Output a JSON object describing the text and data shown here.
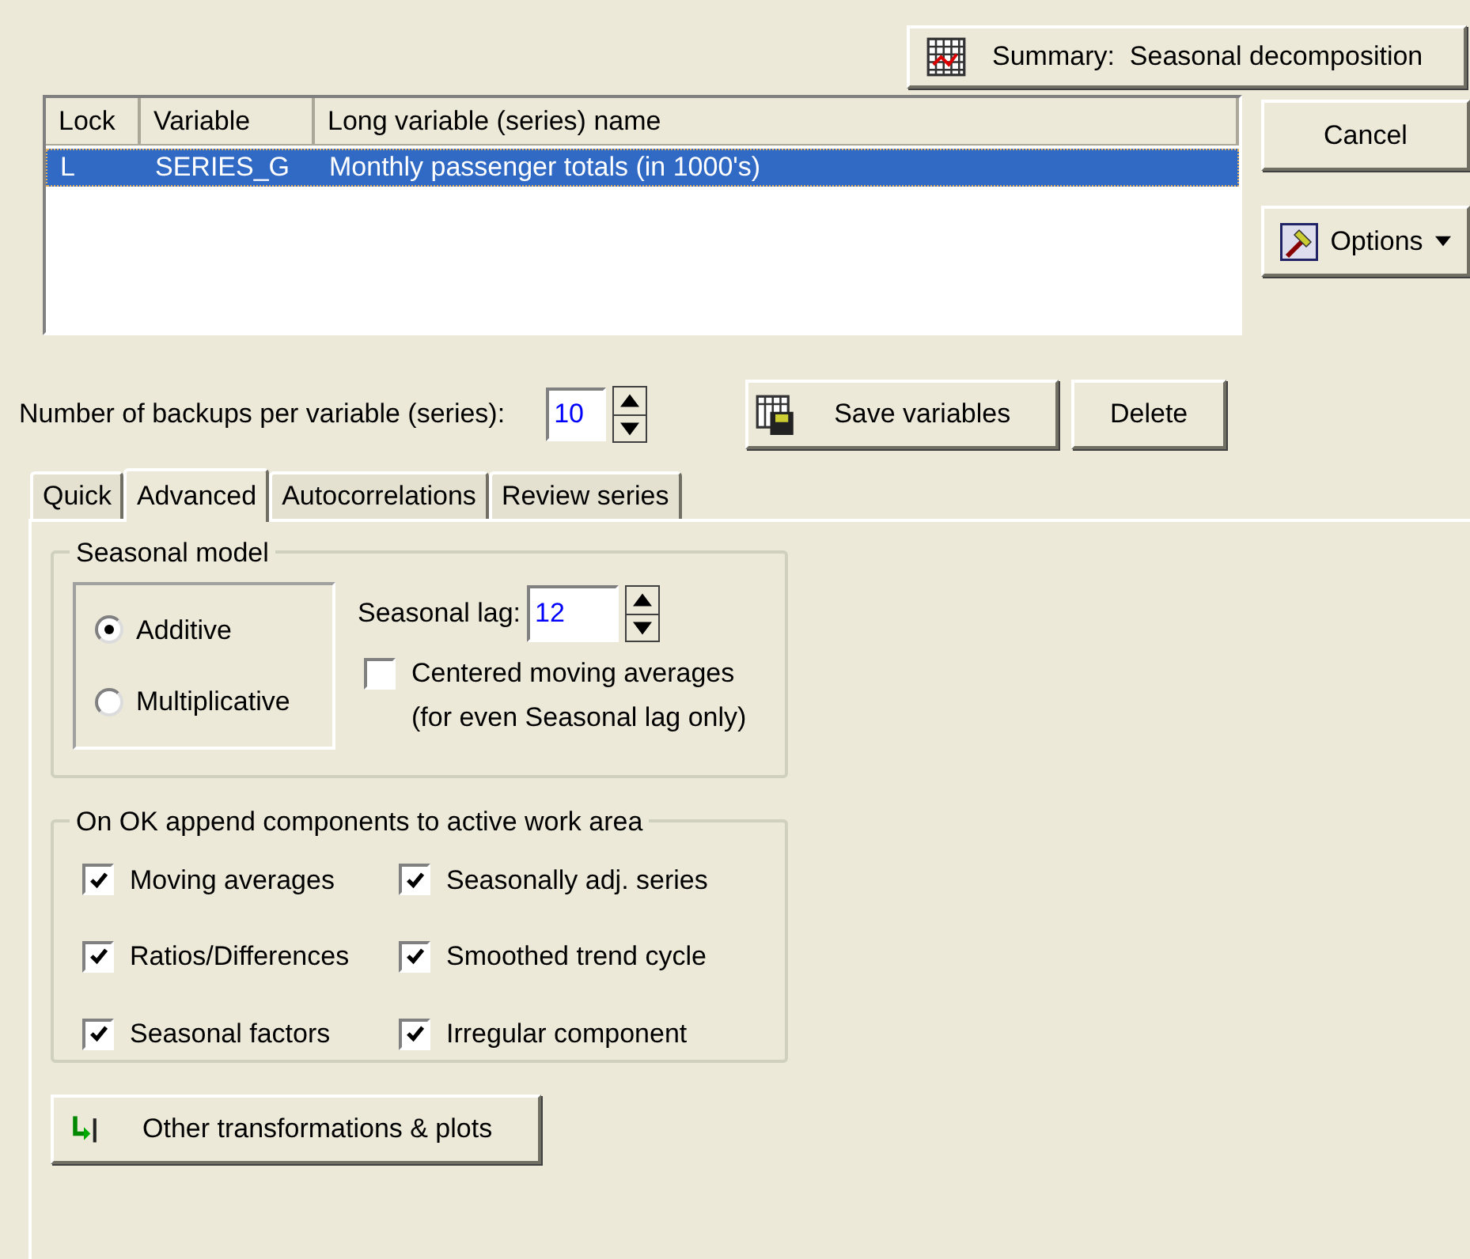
{
  "summary_button": {
    "label": "Summary:  Seasonal decomposition"
  },
  "variables_table": {
    "columns": [
      "Lock",
      "Variable",
      "Long variable (series) name"
    ],
    "rows": [
      {
        "cells": [
          "L",
          "SERIES_G",
          "Monthly passenger totals (in 1000's)"
        ],
        "selected": true
      }
    ]
  },
  "side_buttons": [
    {
      "label": "Cancel",
      "kind": "plain"
    },
    {
      "label": "Options",
      "kind": "menu"
    }
  ],
  "backups": {
    "label": "Number of backups per variable (series):",
    "value": "10"
  },
  "action_buttons": [
    {
      "label": "Save variables",
      "kind": "save"
    },
    {
      "label": "Delete",
      "kind": "plain"
    }
  ],
  "tabs": [
    {
      "label": "Quick",
      "selected": false
    },
    {
      "label": "Advanced",
      "selected": true
    },
    {
      "label": "Autocorrelations",
      "selected": false
    },
    {
      "label": "Review series",
      "selected": false
    }
  ],
  "seasonal_model": {
    "title": "Seasonal model",
    "options": [
      {
        "label": "Additive",
        "selected": true
      },
      {
        "label": "Multiplicative",
        "selected": false
      }
    ],
    "lag": {
      "label": "Seasonal lag:",
      "value": "12"
    },
    "centered": {
      "label": "Centered moving averages",
      "note": "(for even Seasonal lag only)",
      "checked": false
    }
  },
  "components": {
    "title": "On OK append components to active work area",
    "items": [
      {
        "label": "Moving averages",
        "checked": true
      },
      {
        "label": "Seasonally adj. series",
        "checked": true
      },
      {
        "label": "Ratios/Differences",
        "checked": true
      },
      {
        "label": "Smoothed trend cycle",
        "checked": true
      },
      {
        "label": "Seasonal factors",
        "checked": true
      },
      {
        "label": "Irregular component",
        "checked": true
      }
    ]
  },
  "other_button": {
    "label": "Other transformations & plots"
  }
}
